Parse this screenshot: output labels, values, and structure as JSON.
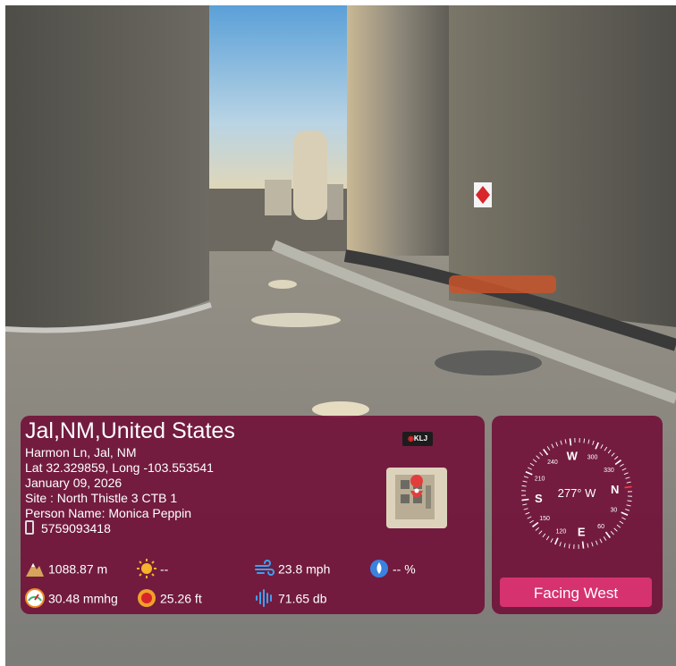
{
  "location": {
    "title": "Jal,NM,United States",
    "address": "Harmon Ln, Jal, NM",
    "coords": "Lat 32.329859, Long -103.553541",
    "date": "January 09, 2026",
    "site": "Site : North Thistle 3 CTB 1",
    "person": "Person Name: Monica Peppin",
    "phone": "5759093418"
  },
  "logo": {
    "text": "KLJ"
  },
  "metrics": {
    "altitude": "1088.87 m",
    "weather": "--",
    "wind": "23.8 mph",
    "humidity": "-- %",
    "pressure": "30.48 mmhg",
    "sound_level": "25.26 ft",
    "decibel": "71.65 db"
  },
  "compass": {
    "heading_text": "277° W",
    "heading_deg": 277,
    "cardinals": [
      "N",
      "E",
      "S",
      "W"
    ],
    "degree_labels": [
      "30",
      "60",
      "120",
      "150",
      "210",
      "240",
      "300",
      "330"
    ]
  },
  "facing_button": {
    "label": "Facing West"
  },
  "colors": {
    "panel": "#700a34",
    "button": "#d6326f",
    "accent_red": "#ff3b3b"
  }
}
